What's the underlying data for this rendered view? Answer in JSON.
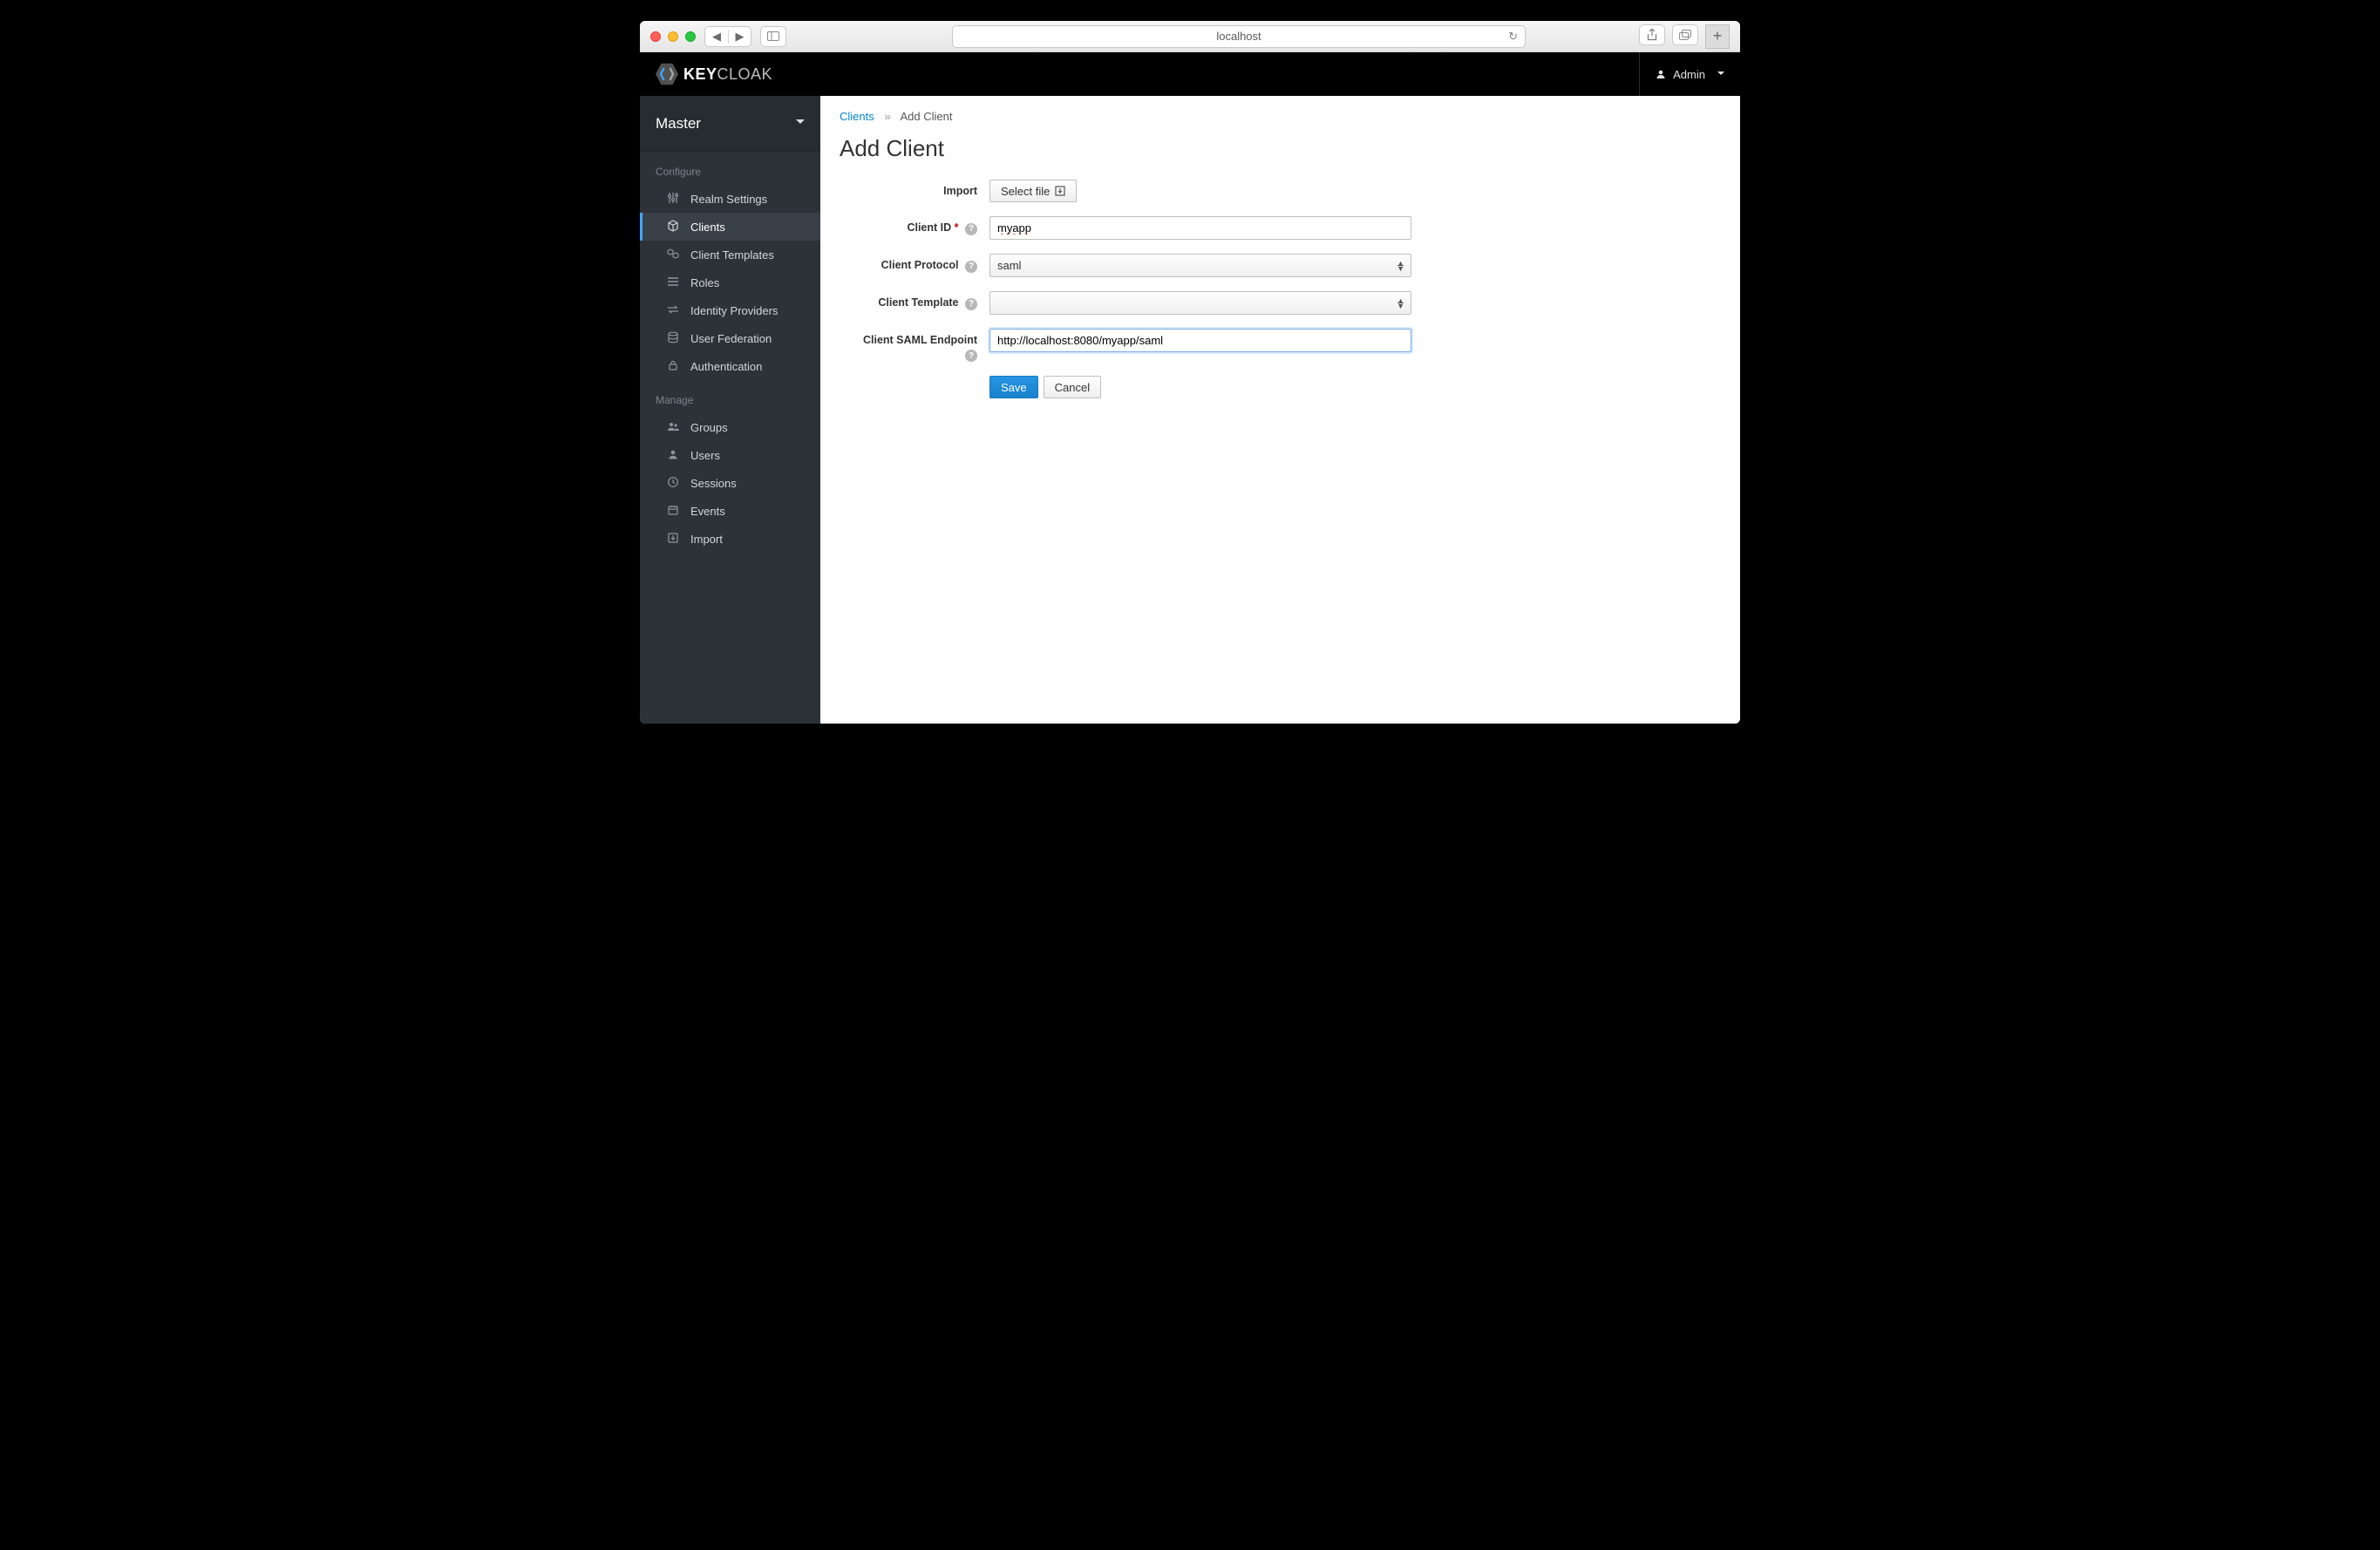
{
  "browser": {
    "url_display": "localhost"
  },
  "header": {
    "app_name_strong": "KEY",
    "app_name_light": "CLOAK",
    "user_label": "Admin"
  },
  "sidebar": {
    "realm": "Master",
    "section_configure": "Configure",
    "section_manage": "Manage",
    "configure": [
      {
        "label": "Realm Settings"
      },
      {
        "label": "Clients"
      },
      {
        "label": "Client Templates"
      },
      {
        "label": "Roles"
      },
      {
        "label": "Identity Providers"
      },
      {
        "label": "User Federation"
      },
      {
        "label": "Authentication"
      }
    ],
    "manage": [
      {
        "label": "Groups"
      },
      {
        "label": "Users"
      },
      {
        "label": "Sessions"
      },
      {
        "label": "Events"
      },
      {
        "label": "Import"
      }
    ]
  },
  "breadcrumb": {
    "link": "Clients",
    "current": "Add Client"
  },
  "page_title": "Add Client",
  "form": {
    "import_label": "Import",
    "select_file_label": "Select file",
    "client_id_label": "Client ID",
    "client_id_value": "myapp",
    "client_protocol_label": "Client Protocol",
    "client_protocol_value": "saml",
    "client_template_label": "Client Template",
    "client_template_value": "",
    "saml_endpoint_label": "Client SAML Endpoint",
    "saml_endpoint_value": "http://localhost:8080/myapp/saml",
    "save_label": "Save",
    "cancel_label": "Cancel"
  }
}
